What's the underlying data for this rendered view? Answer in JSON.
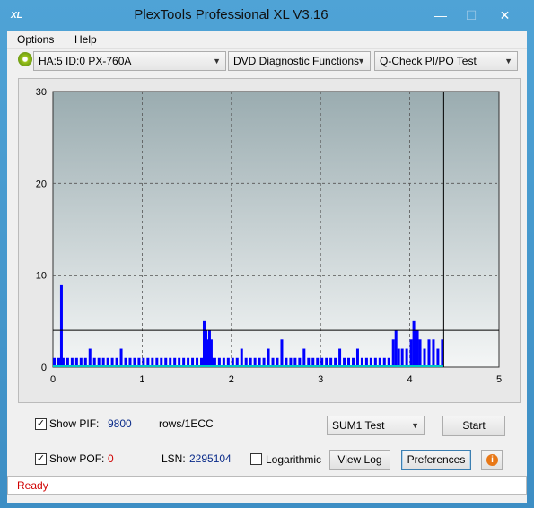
{
  "window": {
    "title": "PlexTools Professional XL V3.16",
    "icon_text": "XL",
    "minimize": "—",
    "maximize": "☐",
    "close": "✕"
  },
  "menu": {
    "items": [
      "Options",
      "Help"
    ]
  },
  "toolbar": {
    "drive": "HA:5 ID:0  PX-760A",
    "function": "DVD Diagnostic Functions",
    "test": "Q-Check PI/PO Test"
  },
  "chart_data": {
    "type": "bar",
    "xlim": [
      0,
      5
    ],
    "ylim": [
      0,
      30
    ],
    "x_ticks": [
      "0",
      "1",
      "2",
      "3",
      "4",
      "5"
    ],
    "y_ticks": [
      "0",
      "10",
      "20",
      "30"
    ],
    "threshold": 4,
    "end_marker_x": 4.38,
    "grid": true,
    "colors": {
      "bars": "#0000ff",
      "baseline": "#00c8c8",
      "threshold": "#000000"
    },
    "series": [
      {
        "values_x": [
          0.0,
          0.05,
          0.08,
          0.1,
          0.15,
          0.2,
          0.25,
          0.3,
          0.35,
          0.4,
          0.45,
          0.5,
          0.55,
          0.6,
          0.65,
          0.7,
          0.75,
          0.8,
          0.85,
          0.9,
          0.95,
          1.0,
          1.05,
          1.1,
          1.15,
          1.2,
          1.25,
          1.3,
          1.35,
          1.4,
          1.45,
          1.5,
          1.55,
          1.6,
          1.65,
          1.68,
          1.7,
          1.72,
          1.74,
          1.76,
          1.78,
          1.8,
          1.85,
          1.9,
          1.95,
          2.0,
          2.05,
          2.1,
          2.15,
          2.2,
          2.25,
          2.3,
          2.35,
          2.4,
          2.45,
          2.5,
          2.55,
          2.6,
          2.65,
          2.7,
          2.75,
          2.8,
          2.85,
          2.9,
          2.95,
          3.0,
          3.05,
          3.1,
          3.15,
          3.2,
          3.25,
          3.3,
          3.35,
          3.4,
          3.45,
          3.5,
          3.55,
          3.6,
          3.65,
          3.7,
          3.75,
          3.8,
          3.83,
          3.86,
          3.9,
          3.95,
          4.0,
          4.03,
          4.05,
          4.07,
          4.1,
          4.15,
          4.2,
          4.25,
          4.3,
          4.35
        ],
        "values_y": [
          1,
          1,
          9,
          1,
          1,
          1,
          1,
          1,
          1,
          2,
          1,
          1,
          1,
          1,
          1,
          1,
          2,
          1,
          1,
          1,
          1,
          1,
          1,
          1,
          1,
          1,
          1,
          1,
          1,
          1,
          1,
          1,
          1,
          1,
          1,
          5,
          4,
          3,
          4,
          3,
          1,
          1,
          1,
          1,
          1,
          1,
          1,
          2,
          1,
          1,
          1,
          1,
          1,
          2,
          1,
          1,
          3,
          1,
          1,
          1,
          1,
          2,
          1,
          1,
          1,
          1,
          1,
          1,
          1,
          2,
          1,
          1,
          1,
          2,
          1,
          1,
          1,
          1,
          1,
          1,
          1,
          3,
          4,
          2,
          2,
          2,
          3,
          5,
          4,
          4,
          3,
          2,
          3,
          3,
          2,
          3
        ]
      }
    ]
  },
  "controls": {
    "show_pif_label": "Show PIF:",
    "show_pif_checked": "✓",
    "pif_value": "9800",
    "pif_unit": "rows/1ECC",
    "show_pof_label": "Show POF:",
    "show_pof_checked": "✓",
    "pof_value": "0",
    "lsn_label": "LSN:",
    "lsn_value": "2295104",
    "logarithmic_label": "Logarithmic",
    "sum_select": "SUM1 Test",
    "start_button": "Start",
    "view_log_button": "View Log",
    "preferences_button": "Preferences",
    "info_icon": "i"
  },
  "status": {
    "text": "Ready"
  }
}
